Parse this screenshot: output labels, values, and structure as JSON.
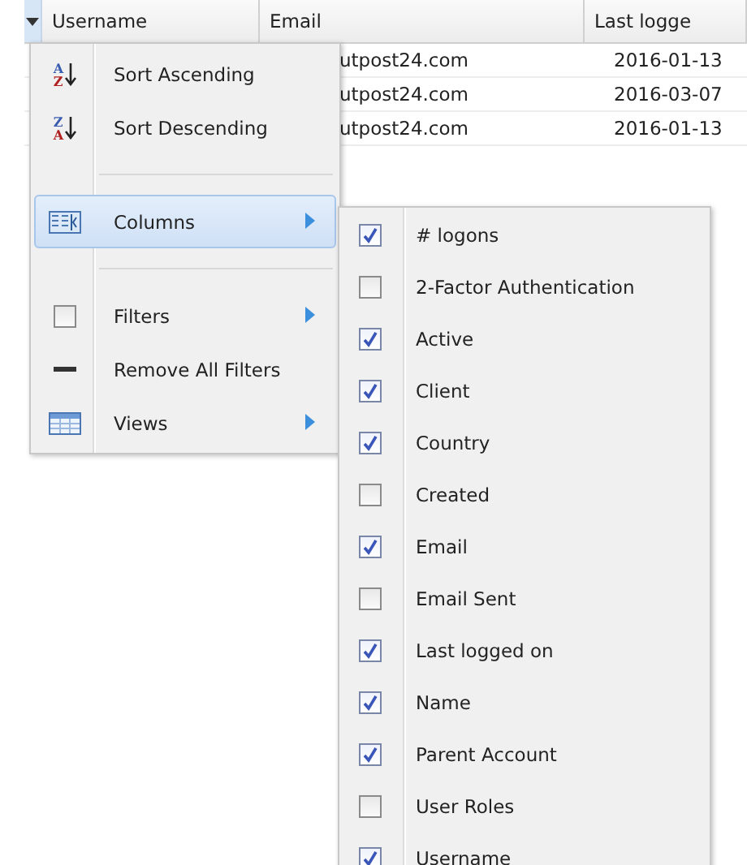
{
  "grid": {
    "columns": [
      {
        "label": "Username"
      },
      {
        "label": "Email"
      },
      {
        "label": "Last logge"
      }
    ],
    "rows": [
      [
        "",
        "utpost24.com",
        "2016-01-13"
      ],
      [
        "",
        "utpost24.com",
        "2016-03-07"
      ],
      [
        "",
        "utpost24.com",
        "2016-01-13"
      ]
    ]
  },
  "menu": {
    "items": [
      {
        "kind": "sort",
        "label": "Sort Ascending",
        "top": "A",
        "bottom": "Z",
        "submenu": false,
        "selected": false
      },
      {
        "kind": "sort",
        "label": "Sort Descending",
        "top": "Z",
        "bottom": "A",
        "submenu": false,
        "selected": false
      },
      {
        "kind": "separator"
      },
      {
        "kind": "columns",
        "label": "Columns",
        "submenu": true,
        "selected": true
      },
      {
        "kind": "separator"
      },
      {
        "kind": "check",
        "label": "Filters",
        "checked": false,
        "submenu": true,
        "selected": false
      },
      {
        "kind": "dash",
        "label": "Remove All Filters",
        "submenu": false,
        "selected": false
      },
      {
        "kind": "views",
        "label": "Views",
        "submenu": true,
        "selected": false
      }
    ]
  },
  "columns_menu": [
    {
      "label": "# logons",
      "checked": true
    },
    {
      "label": "2-Factor Authentication",
      "checked": false
    },
    {
      "label": "Active",
      "checked": true
    },
    {
      "label": "Client",
      "checked": true
    },
    {
      "label": "Country",
      "checked": true
    },
    {
      "label": "Created",
      "checked": false
    },
    {
      "label": "Email",
      "checked": true
    },
    {
      "label": "Email Sent",
      "checked": false
    },
    {
      "label": "Last logged on",
      "checked": true
    },
    {
      "label": "Name",
      "checked": true
    },
    {
      "label": "Parent Account",
      "checked": true
    },
    {
      "label": "User Roles",
      "checked": false
    },
    {
      "label": "Username",
      "checked": true
    }
  ]
}
